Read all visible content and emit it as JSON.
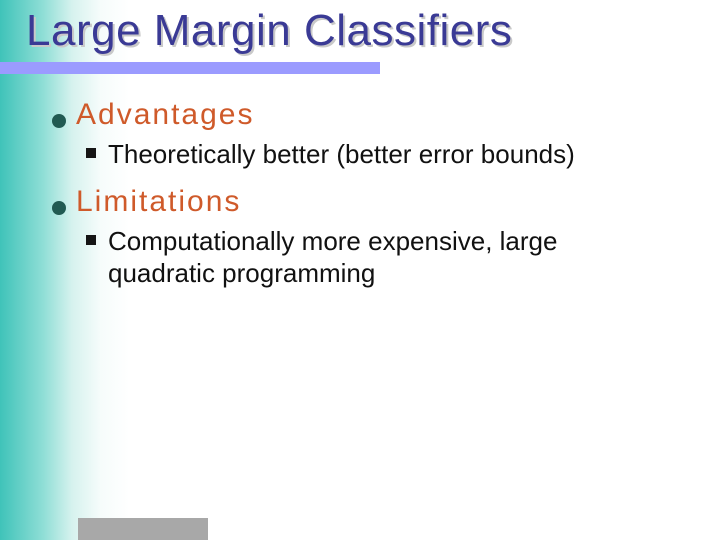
{
  "title": "Large Margin Classifiers",
  "sections": [
    {
      "heading": "Advantages",
      "items": [
        "Theoretically better (better error bounds)"
      ]
    },
    {
      "heading": "Limitations",
      "items": [
        "Computationally more expensive,  large quadratic programming"
      ]
    }
  ]
}
